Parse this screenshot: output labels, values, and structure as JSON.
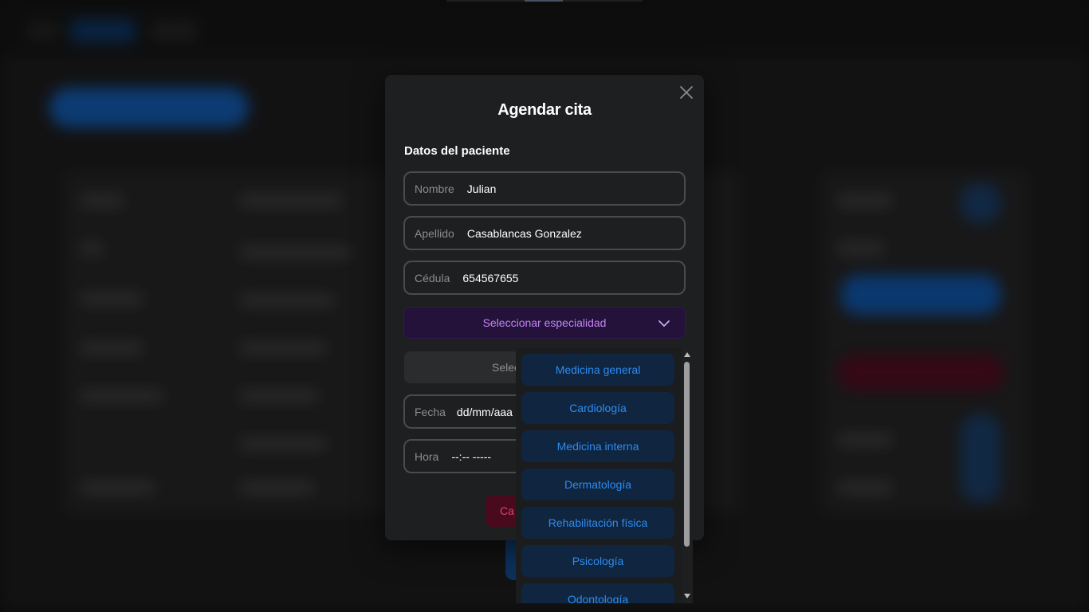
{
  "modal": {
    "title": "Agendar cita",
    "section_title": "Datos del paciente",
    "close_icon": "close-icon",
    "fields": {
      "nombre": {
        "label": "Nombre",
        "value": "Julian"
      },
      "apellido": {
        "label": "Apellido",
        "value": "Casablancas Gonzalez"
      },
      "cedula": {
        "label": "Cédula",
        "value": "654567655"
      },
      "fecha": {
        "label": "Fecha",
        "value": "dd/mm/aaa"
      },
      "hora": {
        "label": "Hora",
        "value": "--:-- -----"
      }
    },
    "especialidad_select": {
      "label": "Seleccionar especialidad",
      "icon": "chevron-down-icon"
    },
    "medico_select": {
      "label": "Selec"
    },
    "cancel_button": {
      "label": "Ca"
    }
  },
  "dropdown": {
    "items": [
      "Medicina general",
      "Cardiología",
      "Medicina interna",
      "Dermatología",
      "Rehabilitación física",
      "Psicología",
      "Odontología"
    ]
  },
  "colors": {
    "accent_purple": "#c384f2",
    "accent_blue": "#2d8cf0",
    "danger": "#e0436e",
    "modal_bg": "#1e1f20"
  }
}
